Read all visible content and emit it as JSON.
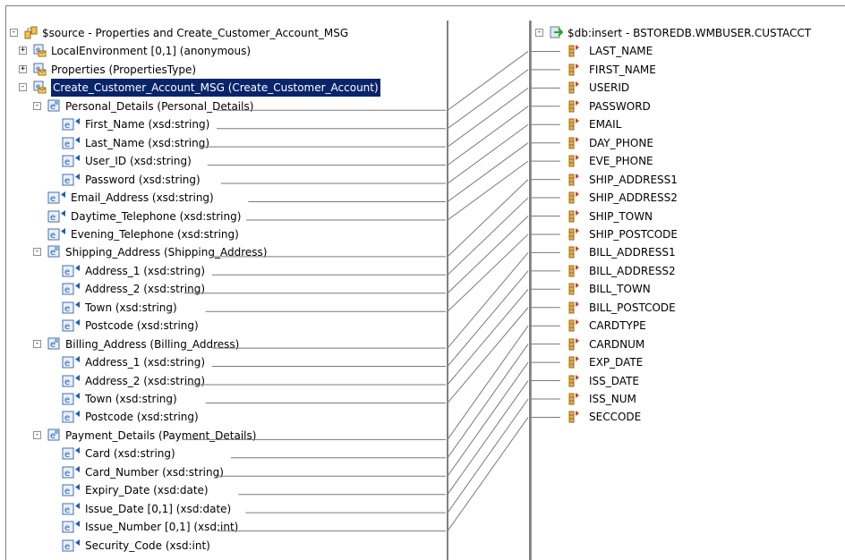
{
  "left_tree": {
    "root": "$source - Properties and Create_Customer_Account_MSG",
    "items": [
      "LocalEnvironment [0,1] (anonymous)",
      "Properties (PropertiesType)",
      "Create_Customer_Account_MSG (Create_Customer_Account)",
      "Personal_Details (Personal_Details)",
      "First_Name (xsd:string)",
      "Last_Name (xsd:string)",
      "User_ID (xsd:string)",
      "Password (xsd:string)",
      "Email_Address (xsd:string)",
      "Daytime_Telephone (xsd:string)",
      "Evening_Telephone (xsd:string)",
      "Shipping_Address (Shipping_Address)",
      "Address_1 (xsd:string)",
      "Address_2 (xsd:string)",
      "Town (xsd:string)",
      "Postcode (xsd:string)",
      "Billing_Address (Billing_Address)",
      "Address_1 (xsd:string)",
      "Address_2 (xsd:string)",
      "Town (xsd:string)",
      "Postcode (xsd:string)",
      "Payment_Details (Payment_Details)",
      "Card (xsd:string)",
      "Card_Number (xsd:string)",
      "Expiry_Date (xsd:date)",
      "Issue_Date [0,1] (xsd:date)",
      "Issue_Number [0,1] (xsd:int)",
      "Security_Code (xsd:int)"
    ]
  },
  "right_tree": {
    "root": "$db:insert - BSTOREDB.WMBUSER.CUSTACCT",
    "columns": [
      "LAST_NAME",
      "FIRST_NAME",
      "USERID",
      "PASSWORD",
      "EMAIL",
      "DAY_PHONE",
      "EVE_PHONE",
      "SHIP_ADDRESS1",
      "SHIP_ADDRESS2",
      "SHIP_TOWN",
      "SHIP_POSTCODE",
      "BILL_ADDRESS1",
      "BILL_ADDRESS2",
      "BILL_TOWN",
      "BILL_POSTCODE",
      "CARDTYPE",
      "CARDNUM",
      "EXP_DATE",
      "ISS_DATE",
      "ISS_NUM",
      "SECCODE"
    ]
  },
  "colors": {
    "selection": "#0a246a",
    "connector": "#7a7a7a",
    "column_icon": "#d8a040"
  }
}
